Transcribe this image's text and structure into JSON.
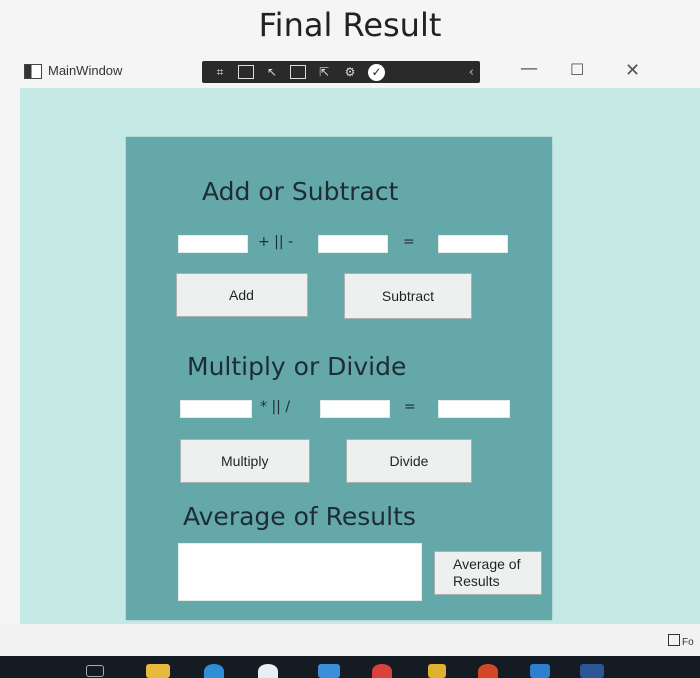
{
  "page_title": "Final Result",
  "window": {
    "title": "MainWindow",
    "minimize_glyph": "—",
    "maximize_glyph": "☐",
    "close_glyph": "✕"
  },
  "toolbar": {
    "icons": [
      "select-element-icon",
      "display-layout-icon",
      "track-focus-icon",
      "hot-reload-icon",
      "binding-failures-icon",
      "accessibility-check-icon"
    ],
    "collapse_glyph": "‹"
  },
  "add_subtract": {
    "heading": "Add or Subtract",
    "operator": "+ || -",
    "equals": "=",
    "first_value": "",
    "second_value": "",
    "result_value": "",
    "add_label": "Add",
    "subtract_label": "Subtract"
  },
  "multiply_divide": {
    "heading": "Multiply or Divide",
    "operator": "* || /",
    "equals": "=",
    "first_value": "",
    "second_value": "",
    "result_value": "",
    "multiply_label": "Multiply",
    "divide_label": "Divide"
  },
  "average": {
    "heading": "Average of Results",
    "result_value": "",
    "button_label_line1": "Average of",
    "button_label_line2": "Results"
  },
  "corner_text": "Fo",
  "colors": {
    "client_background": "#c5e9e5",
    "panel_background": "#64a8a9",
    "button_background": "#eef0f0",
    "taskbar": "#151b22"
  }
}
